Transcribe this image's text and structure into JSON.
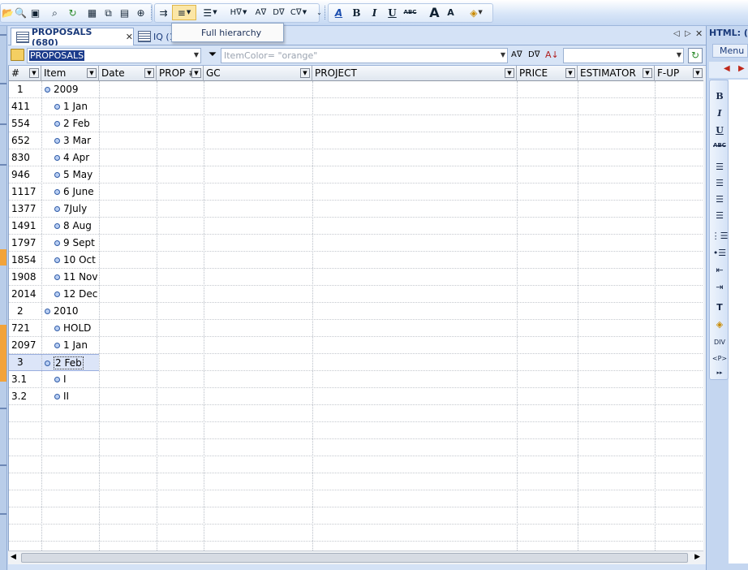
{
  "popup": {
    "label": "Full hierarchy"
  },
  "tabs": [
    {
      "label": "PROPOSALS (680)",
      "active": true
    },
    {
      "label": "IQ (1"
    }
  ],
  "filterbar": {
    "folder_value": "PROPOSALS",
    "filter_value": "ItemColor= \"orange\""
  },
  "columns": [
    "#",
    "Item",
    "Date",
    "PROP #",
    "GC",
    "PROJECT",
    "PRICE",
    "ESTIMATOR",
    "F-UP"
  ],
  "rows": [
    {
      "num": "1",
      "item": "2009",
      "level": 0
    },
    {
      "num": "411",
      "item": "1 Jan",
      "level": 1
    },
    {
      "num": "554",
      "item": "2 Feb",
      "level": 1
    },
    {
      "num": "652",
      "item": "3 Mar",
      "level": 1
    },
    {
      "num": "830",
      "item": "4 Apr",
      "level": 1
    },
    {
      "num": "946",
      "item": "5 May",
      "level": 1
    },
    {
      "num": "1117",
      "item": "6 June",
      "level": 1
    },
    {
      "num": "1377",
      "item": "7July",
      "level": 1
    },
    {
      "num": "1491",
      "item": "8 Aug",
      "level": 1
    },
    {
      "num": "1797",
      "item": "9 Sept",
      "level": 1
    },
    {
      "num": "1854",
      "item": "10 Oct",
      "level": 1
    },
    {
      "num": "1908",
      "item": "11 Nov",
      "level": 1
    },
    {
      "num": "2014",
      "item": "12 Dec",
      "level": 1
    },
    {
      "num": "2",
      "item": "2010",
      "level": 0
    },
    {
      "num": "721",
      "item": "HOLD",
      "level": 1
    },
    {
      "num": "2097",
      "item": "1 Jan",
      "level": 1
    },
    {
      "num": "3",
      "item": "2 Feb",
      "level": 0,
      "selected": true
    },
    {
      "num": "3.1",
      "item": "I",
      "level": 1
    },
    {
      "num": "3.2",
      "item": "II",
      "level": 1
    }
  ],
  "right_panel": {
    "title": "HTML: (",
    "menu": "Menu"
  },
  "colors": {
    "selection": "#dce5f8",
    "toolbar_active": "#fbe6a6",
    "tab_text": "#1a3a7a"
  }
}
